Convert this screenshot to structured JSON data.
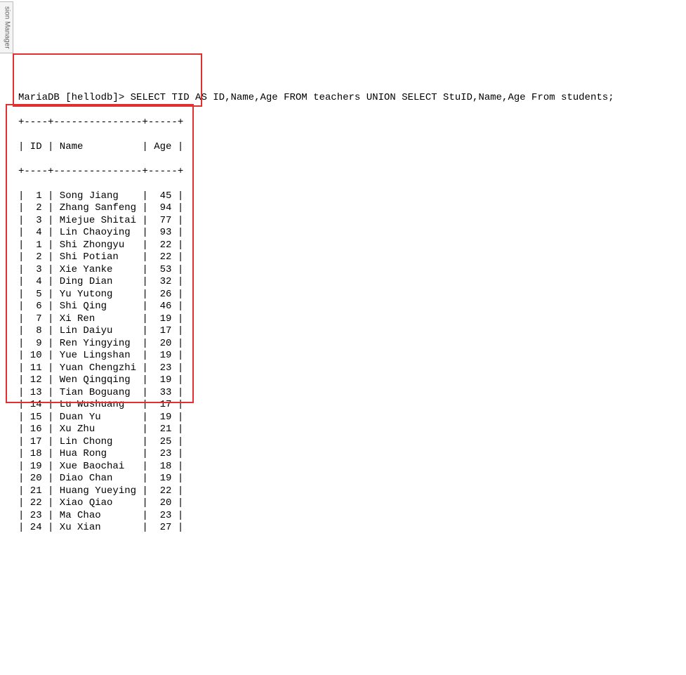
{
  "sidebar": {
    "tab_label": "sion Manager"
  },
  "prompt": "MariaDB [hellodb]> ",
  "query": "SELECT TID AS ID,Name,Age FROM teachers UNION SELECT StuID,Name,Age From students;",
  "columns": [
    "ID",
    "Name",
    "Age"
  ],
  "header_line": "| ID | Name          | Age |",
  "border_line": "+----+---------------+-----+",
  "teachers": [
    {
      "id": 1,
      "name": "Song Jiang",
      "age": 45
    },
    {
      "id": 2,
      "name": "Zhang Sanfeng",
      "age": 94
    },
    {
      "id": 3,
      "name": "Miejue Shitai",
      "age": 77
    },
    {
      "id": 4,
      "name": "Lin Chaoying",
      "age": 93
    }
  ],
  "students": [
    {
      "id": 1,
      "name": "Shi Zhongyu",
      "age": 22
    },
    {
      "id": 2,
      "name": "Shi Potian",
      "age": 22
    },
    {
      "id": 3,
      "name": "Xie Yanke",
      "age": 53
    },
    {
      "id": 4,
      "name": "Ding Dian",
      "age": 32
    },
    {
      "id": 5,
      "name": "Yu Yutong",
      "age": 26
    },
    {
      "id": 6,
      "name": "Shi Qing",
      "age": 46
    },
    {
      "id": 7,
      "name": "Xi Ren",
      "age": 19
    },
    {
      "id": 8,
      "name": "Lin Daiyu",
      "age": 17
    },
    {
      "id": 9,
      "name": "Ren Yingying",
      "age": 20
    },
    {
      "id": 10,
      "name": "Yue Lingshan",
      "age": 19
    },
    {
      "id": 11,
      "name": "Yuan Chengzhi",
      "age": 23
    },
    {
      "id": 12,
      "name": "Wen Qingqing",
      "age": 19
    },
    {
      "id": 13,
      "name": "Tian Boguang",
      "age": 33
    },
    {
      "id": 14,
      "name": "Lu Wushuang",
      "age": 17
    },
    {
      "id": 15,
      "name": "Duan Yu",
      "age": 19
    },
    {
      "id": 16,
      "name": "Xu Zhu",
      "age": 21
    },
    {
      "id": 17,
      "name": "Lin Chong",
      "age": 25
    },
    {
      "id": 18,
      "name": "Hua Rong",
      "age": 23
    },
    {
      "id": 19,
      "name": "Xue Baochai",
      "age": 18
    },
    {
      "id": 20,
      "name": "Diao Chan",
      "age": 19
    },
    {
      "id": 21,
      "name": "Huang Yueying",
      "age": 22
    },
    {
      "id": 22,
      "name": "Xiao Qiao",
      "age": 20
    },
    {
      "id": 23,
      "name": "Ma Chao",
      "age": 23
    },
    {
      "id": 24,
      "name": "Xu Xian",
      "age": 27
    }
  ],
  "status": {
    "text": ""
  }
}
